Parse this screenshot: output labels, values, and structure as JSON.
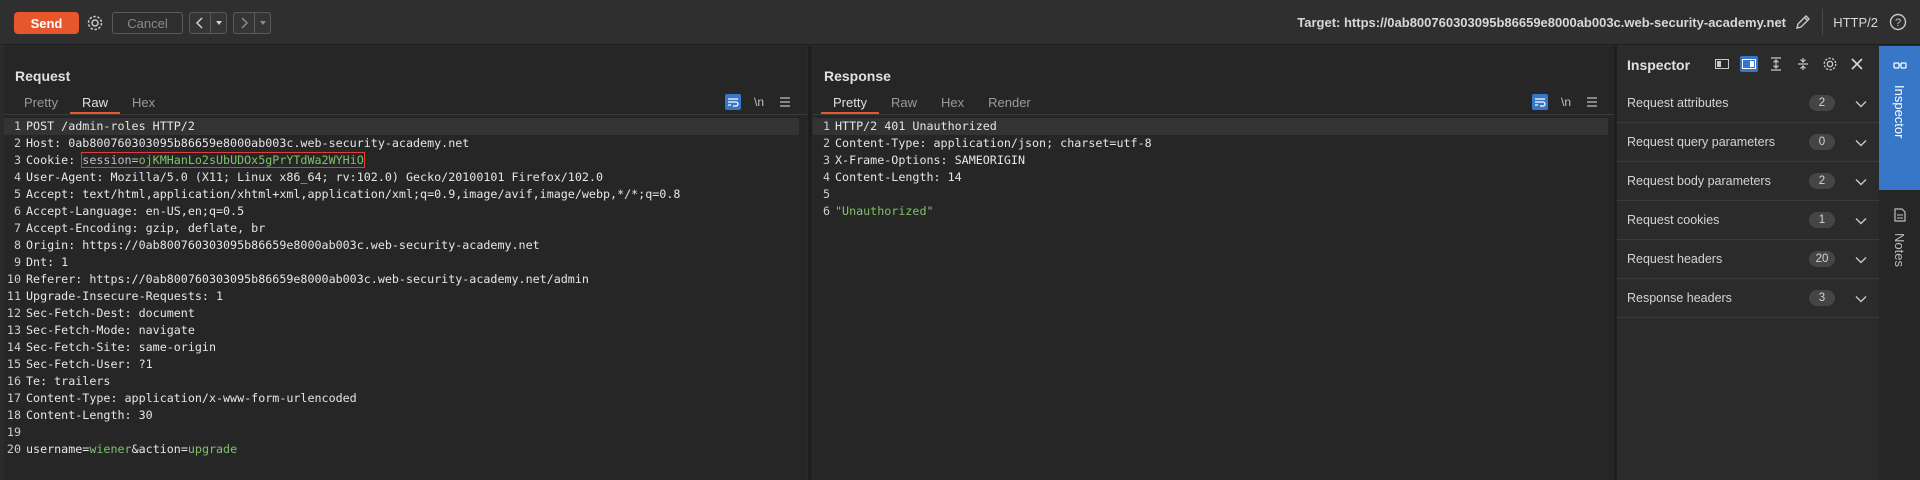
{
  "toolbar": {
    "send_label": "Send",
    "cancel_label": "Cancel",
    "target_label": "Target: https://0ab800760303095b86659e8000ab003c.web-security-academy.net",
    "protocol_label": "HTTP/2"
  },
  "request": {
    "title": "Request",
    "tabs": [
      "Pretty",
      "Raw",
      "Hex"
    ],
    "active_tab": "Raw",
    "lines": [
      {
        "n": "1",
        "text": "POST /admin-roles HTTP/2"
      },
      {
        "n": "2",
        "text": "Host: 0ab800760303095b86659e8000ab003c.web-security-academy.net"
      },
      {
        "n": "3",
        "key": "Cookie: ",
        "cookie_name": "session=",
        "cookie_value": "ojKMHanLo2sUbUDOx5gPrYTdWa2WYHiO"
      },
      {
        "n": "4",
        "text": "User-Agent: Mozilla/5.0 (X11; Linux x86_64; rv:102.0) Gecko/20100101 Firefox/102.0"
      },
      {
        "n": "5",
        "text": "Accept: text/html,application/xhtml+xml,application/xml;q=0.9,image/avif,image/webp,*/*;q=0.8"
      },
      {
        "n": "6",
        "text": "Accept-Language: en-US,en;q=0.5"
      },
      {
        "n": "7",
        "text": "Accept-Encoding: gzip, deflate, br"
      },
      {
        "n": "8",
        "text": "Origin: https://0ab800760303095b86659e8000ab003c.web-security-academy.net"
      },
      {
        "n": "9",
        "text": "Dnt: 1"
      },
      {
        "n": "10",
        "text": "Referer: https://0ab800760303095b86659e8000ab003c.web-security-academy.net/admin"
      },
      {
        "n": "11",
        "text": "Upgrade-Insecure-Requests: 1"
      },
      {
        "n": "12",
        "text": "Sec-Fetch-Dest: document"
      },
      {
        "n": "13",
        "text": "Sec-Fetch-Mode: navigate"
      },
      {
        "n": "14",
        "text": "Sec-Fetch-Site: same-origin"
      },
      {
        "n": "15",
        "text": "Sec-Fetch-User: ?1"
      },
      {
        "n": "16",
        "text": "Te: trailers"
      },
      {
        "n": "17",
        "text": "Content-Type: application/x-www-form-urlencoded"
      },
      {
        "n": "18",
        "text": "Content-Length: 30"
      },
      {
        "n": "19",
        "text": ""
      },
      {
        "n": "20",
        "body": [
          {
            "t": "username=",
            "g": false
          },
          {
            "t": "wiener",
            "g": true
          },
          {
            "t": "&action=",
            "g": false
          },
          {
            "t": "upgrade",
            "g": true
          }
        ]
      }
    ]
  },
  "response": {
    "title": "Response",
    "tabs": [
      "Pretty",
      "Raw",
      "Hex",
      "Render"
    ],
    "active_tab": "Pretty",
    "lines": [
      {
        "n": "1",
        "text": "HTTP/2 401 Unauthorized"
      },
      {
        "n": "2",
        "text": "Content-Type: application/json; charset=utf-8"
      },
      {
        "n": "3",
        "text": "X-Frame-Options: SAMEORIGIN"
      },
      {
        "n": "4",
        "text": "Content-Length: 14"
      },
      {
        "n": "5",
        "text": ""
      },
      {
        "n": "6",
        "green": "\"Unauthorized\""
      }
    ]
  },
  "inspector": {
    "title": "Inspector",
    "rows": [
      {
        "label": "Request attributes",
        "count": "2"
      },
      {
        "label": "Request query parameters",
        "count": "0"
      },
      {
        "label": "Request body parameters",
        "count": "2"
      },
      {
        "label": "Request cookies",
        "count": "1"
      },
      {
        "label": "Request headers",
        "count": "20"
      },
      {
        "label": "Response headers",
        "count": "3"
      }
    ]
  },
  "side_tabs": {
    "inspector": "Inspector",
    "notes": "Notes"
  },
  "icons": {
    "settings": "gear-icon",
    "back": "chevron-left-icon",
    "forward": "chevron-right-icon",
    "edit_target": "pencil-icon",
    "help": "help-icon",
    "wrap": "wrap-icon",
    "newline": "newline-icon",
    "menu": "menu-icon",
    "close": "close-icon"
  },
  "colors": {
    "accent": "#e8572b",
    "selected": "#3877c8",
    "highlight_value": "#7ec26a",
    "cookie_outline": "#e03a3a"
  }
}
